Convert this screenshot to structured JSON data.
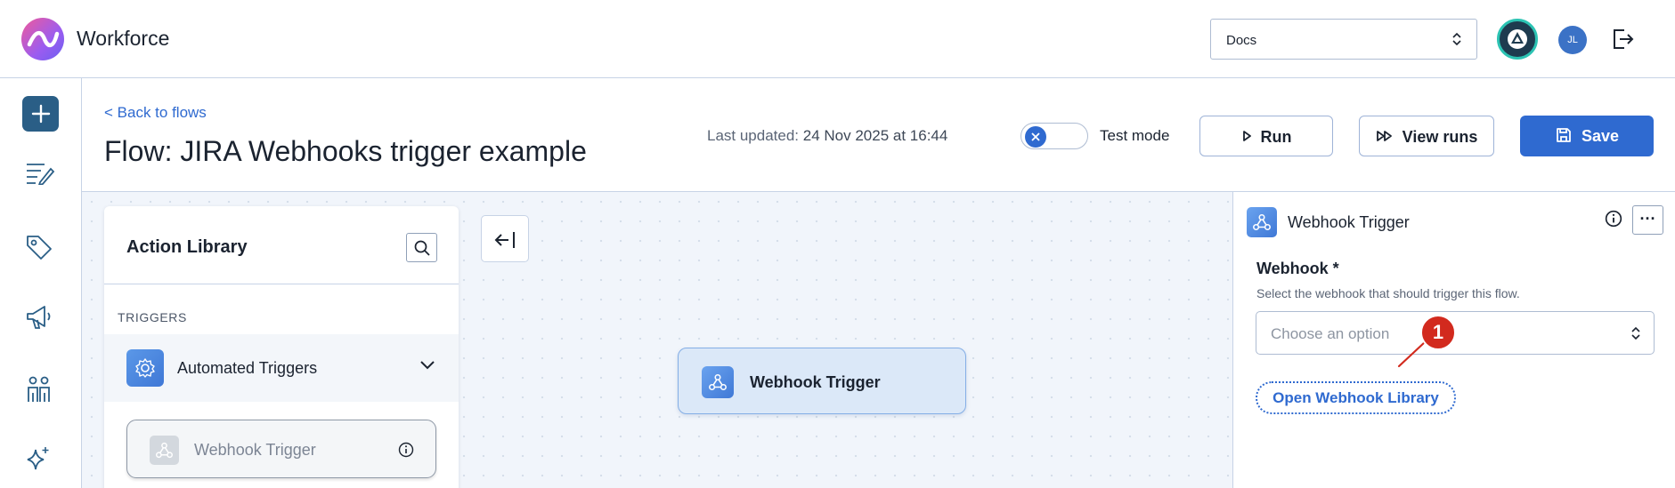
{
  "app": {
    "brand": "Workforce",
    "workspace_select": {
      "value": "Docs"
    },
    "avatar_initials": "JL"
  },
  "nav": {
    "icons": [
      "plus-icon",
      "notes-icon",
      "tag-icon",
      "megaphone-icon",
      "people-icon",
      "sparkle-icon"
    ]
  },
  "flow": {
    "back_link": "< Back to flows",
    "title_prefix": "Flow:",
    "title_name": "JIRA Webhooks trigger example",
    "last_updated_label": "Last updated:",
    "last_updated_value": "24 Nov 2025 at 16:44",
    "test_mode_label": "Test mode",
    "run_label": "Run",
    "view_runs_label": "View runs",
    "save_label": "Save"
  },
  "library": {
    "title": "Action Library",
    "section": "TRIGGERS",
    "group_label": "Automated Triggers",
    "item_label": "Webhook Trigger"
  },
  "canvas": {
    "node_label": "Webhook Trigger"
  },
  "panel": {
    "title": "Webhook Trigger",
    "more_label": "···",
    "field_label": "Webhook *",
    "field_help": "Select the webhook that should trigger this flow.",
    "select_placeholder": "Choose an option",
    "open_library_label": "Open Webhook Library",
    "annotation_number": "1"
  },
  "colors": {
    "accent": "#2f6ad0",
    "rail_button": "#2a5e86",
    "annotation": "#d22a1e"
  }
}
